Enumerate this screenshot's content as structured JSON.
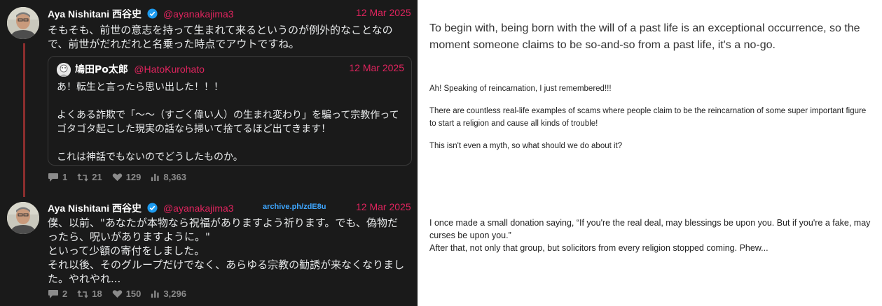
{
  "tweet1": {
    "author_name": "Aya Nishitani 西谷史",
    "handle": "@ayanakajima3",
    "date": "12 Mar 2025",
    "text": "そもそも、前世の意志を持って生まれて来るというのが例外的なことなので、前世がだれだれと名乗った時点でアウトですね。"
  },
  "quote": {
    "author_name": "鳩田Po太郎",
    "handle": "@HatoKurohato",
    "date": "12 Mar 2025",
    "para1": "あ！転生と言ったら思い出した！！！",
    "para2": "よくある詐欺で「～～（すごく偉い人）の生まれ変わり」を騙って宗教作ってゴタゴタ起こした現実の話なら掃いて捨てるほど出てきます！",
    "para3": "これは神話でもないのでどうしたものか。"
  },
  "tweet1_stats": {
    "replies": "1",
    "retweets": "21",
    "likes": "129",
    "views": "8,363"
  },
  "tweet2": {
    "author_name": "Aya Nishitani 西谷史",
    "handle": "@ayanakajima3",
    "date": "12 Mar 2025",
    "archive_link": "archive.ph/zdE8u",
    "line1": "僕、以前、\"あなたが本物なら祝福がありますよう祈ります。でも、偽物だったら、呪いがありますように。\"",
    "line2": "といって少額の寄付をしました。",
    "line3": "それ以後、そのグループだけでなく、あらゆる宗教の勧誘が来なくなりました。やれやれ..."
  },
  "tweet2_stats": {
    "replies": "2",
    "retweets": "18",
    "likes": "150",
    "views": "3,296"
  },
  "translation": {
    "t1": "To begin with, being born with the will of a past life is an exceptional occurrence, so the moment someone claims to be so-and-so from a past life, it's a no-go.",
    "q1": "Ah! Speaking of reincarnation, I just remembered!!!",
    "q2": "There are countless real-life examples of scams where people claim to be the reincarnation of some super important figure to start a religion and cause all kinds of trouble!",
    "q3": "This isn't even a myth, so what should we do about it?",
    "t2a": "I once made a small donation saying, “If you're the real deal, may blessings be upon you. But if you're a fake, may curses be upon you.”",
    "t2b": "After that, not only that group, but solicitors from every religion stopped coming. Phew..."
  },
  "colors": {
    "accent_red": "#e0245e",
    "link_blue": "#3ea6ff",
    "verified_blue": "#1d9bf0",
    "thread_line": "#8b2e2e",
    "panel_bg": "#1a1a1a"
  },
  "icons": [
    "verified-icon",
    "reply-icon",
    "retweet-icon",
    "like-icon",
    "views-icon"
  ]
}
